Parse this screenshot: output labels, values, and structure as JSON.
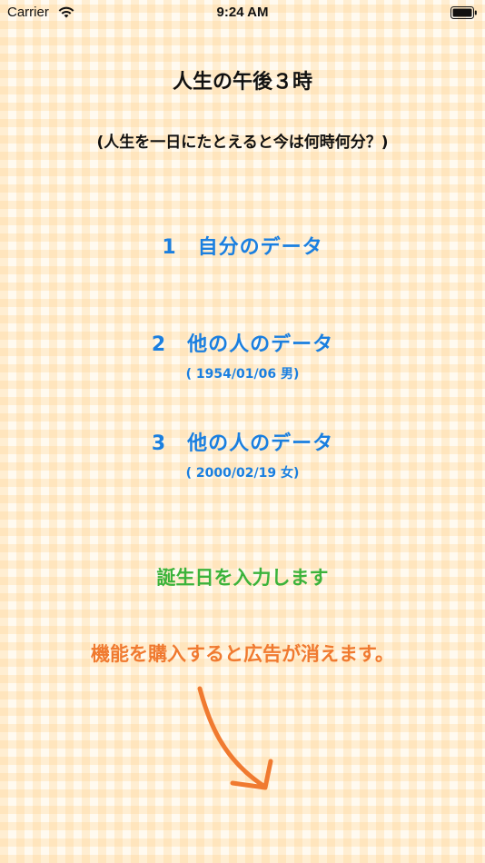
{
  "status_bar": {
    "carrier": "Carrier",
    "time": "9:24 AM"
  },
  "header": {
    "title": "人生の午後３時",
    "subtitle": "(人生を一日にたとえると今は何時何分？)"
  },
  "buttons": [
    {
      "label": "1　自分のデータ",
      "sub": ""
    },
    {
      "label": "2　他の人のデータ",
      "sub": "( 1954/01/06 男)"
    },
    {
      "label": "3　他の人のデータ",
      "sub": "( 2000/02/19 女)"
    }
  ],
  "input_birthday": "誕生日を入力します",
  "ad_notice": "機能を購入すると広告が消えます。",
  "colors": {
    "primary": "#1a7fe0",
    "green": "#3bb33b",
    "orange": "#f07a30"
  },
  "icons": [
    "wifi-icon",
    "battery-icon",
    "arrow-down-right-icon"
  ]
}
